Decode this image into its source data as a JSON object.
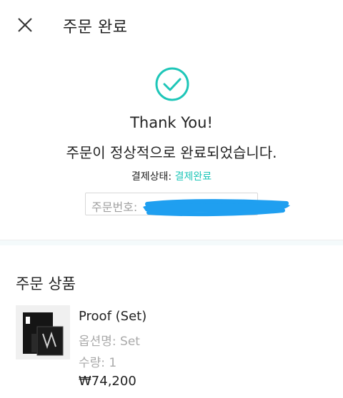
{
  "header": {
    "title": "주문 완료",
    "close_icon": "close-icon"
  },
  "confirmation": {
    "icon": "check-circle-icon",
    "accent_color": "#1ec6b8",
    "thank_you": "Thank You!",
    "message": "주문이 정상적으로 완료되었습니다.",
    "status_label": "결제상태:",
    "status_value": "결제완료",
    "order_number_label": "주문번호:"
  },
  "products": {
    "section_title": "주문 상품",
    "items": [
      {
        "name": "Proof (Set)",
        "option": "옵션명: Set",
        "quantity": "수량: 1",
        "price": "₩74,200"
      }
    ]
  }
}
